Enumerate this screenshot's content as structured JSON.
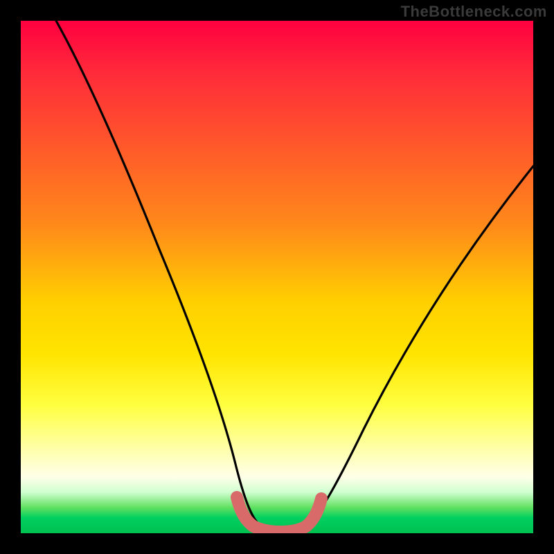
{
  "watermark": "TheBottleneck.com",
  "chart_data": {
    "type": "line",
    "title": "",
    "xlabel": "",
    "ylabel": "",
    "xlim": [
      0,
      100
    ],
    "ylim": [
      0,
      100
    ],
    "series": [
      {
        "name": "bottleneck-curve",
        "x": [
          7,
          12,
          18,
          23,
          28,
          33,
          37,
          40,
          42,
          44,
          46,
          48,
          51,
          54,
          57,
          60,
          65,
          72,
          80,
          90,
          100
        ],
        "values": [
          100,
          88,
          75,
          63,
          51,
          39,
          28,
          19,
          12,
          7,
          4,
          3,
          3,
          4,
          7,
          12,
          21,
          34,
          48,
          64,
          78
        ]
      },
      {
        "name": "sweet-spot-band",
        "x": [
          42,
          44,
          46,
          48,
          50,
          52,
          54,
          56
        ],
        "values": [
          7,
          4,
          3,
          3,
          3,
          3,
          4,
          7
        ]
      }
    ],
    "gradient_stops": [
      {
        "pos": 0,
        "color": "#ff0040"
      },
      {
        "pos": 25,
        "color": "#ff5a2a"
      },
      {
        "pos": 55,
        "color": "#ffd000"
      },
      {
        "pos": 75,
        "color": "#ffff40"
      },
      {
        "pos": 92,
        "color": "#d0ffd0"
      },
      {
        "pos": 100,
        "color": "#00c050"
      }
    ]
  }
}
